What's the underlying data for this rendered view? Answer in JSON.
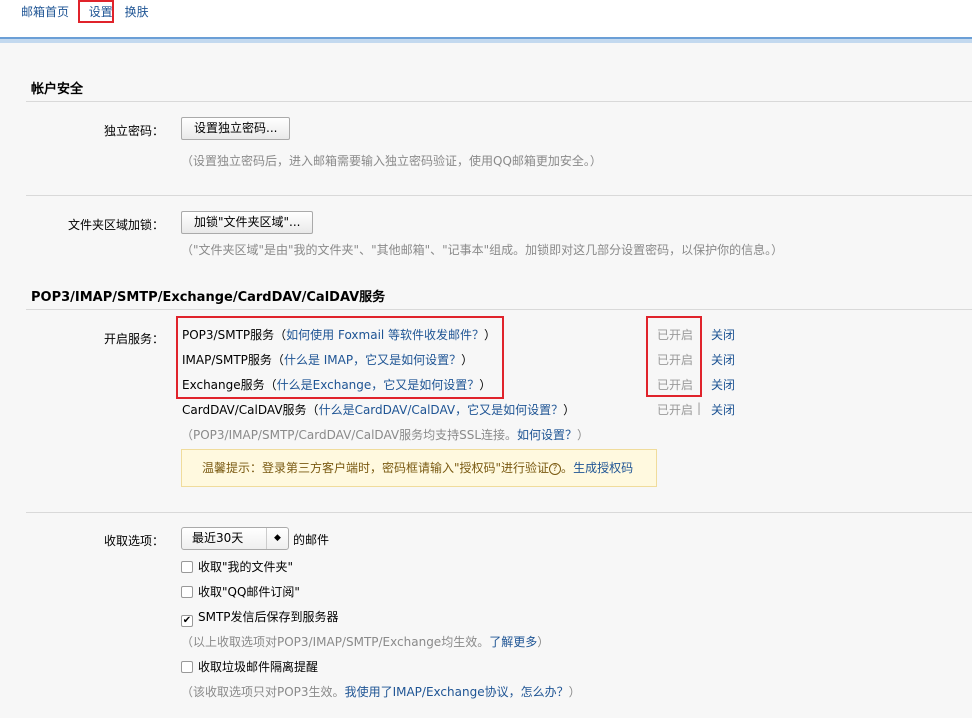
{
  "nav": {
    "home": "邮箱首页",
    "separator": "|",
    "settings": "设置",
    "skin": "换肤"
  },
  "account_security": {
    "title": "帐户安全",
    "password": {
      "label": "独立密码：",
      "button": "设置独立密码...",
      "hint": "（设置独立密码后，进入邮箱需要输入独立密码验证，使用QQ邮箱更加安全。）"
    },
    "folder_lock": {
      "label": "文件夹区域加锁：",
      "button": "加锁\"文件夹区域\"...",
      "hint": "（\"文件夹区域\"是由\"我的文件夹\"、\"其他邮箱\"、\"记事本\"组成。加锁即对这几部分设置密码，以保护你的信息。）"
    }
  },
  "services": {
    "title": "POP3/IMAP/SMTP/Exchange/CardDAV/CalDAV服务",
    "label": "开启服务：",
    "items": [
      {
        "name": "POP3/SMTP服务",
        "open_paren": "（",
        "link": "如何使用 Foxmail 等软件收发邮件？",
        "close_paren": "）",
        "status": "已开启",
        "action": "关闭"
      },
      {
        "name": "IMAP/SMTP服务",
        "open_paren": "（",
        "link": "什么是 IMAP，它又是如何设置？",
        "close_paren": "）",
        "status": "已开启",
        "action": "关闭"
      },
      {
        "name": "Exchange服务",
        "open_paren": "（",
        "link": "什么是Exchange，它又是如何设置？",
        "close_paren": "）",
        "status": "已开启",
        "action": "关闭"
      },
      {
        "name": "CardDAV/CalDAV服务",
        "open_paren": "（",
        "link": "什么是CardDAV/CalDAV，它又是如何设置？",
        "close_paren": "）",
        "status": "已开启",
        "separator": "|",
        "action": "关闭"
      }
    ],
    "ssl_hint": "（POP3/IMAP/SMTP/CardDAV/CalDAV服务均支持SSL连接。",
    "ssl_link": "如何设置？",
    "ssl_hint_end": "）",
    "notice_text": "温馨提示：登录第三方客户端时，密码框请输入\"授权码\"进行验证",
    "notice_icon": "?",
    "notice_link": "生成授权码"
  },
  "fetch": {
    "label": "收取选项：",
    "select_value": "最近30天",
    "select_arrow": "◆",
    "after_select": "的邮件",
    "options": [
      {
        "label": "收取\"我的文件夹\"",
        "checked": false
      },
      {
        "label": "收取\"QQ邮件订阅\"",
        "checked": false
      },
      {
        "label": "SMTP发信后保存到服务器",
        "checked": true
      }
    ],
    "hint1": "（以上收取选项对POP3/IMAP/SMTP/Exchange均生效。",
    "hint1_link": "了解更多",
    "hint1_end": "）",
    "spam_option": {
      "label": "收取垃圾邮件隔离提醒",
      "checked": false
    },
    "hint2": "（该收取选项只对POP3生效。",
    "hint2_link": "我使用了IMAP/Exchange协议，怎么办？",
    "hint2_end": "）",
    "check_mark": "✔"
  },
  "colors": {
    "link": "#1e5494",
    "highlight": "#e0232b"
  }
}
